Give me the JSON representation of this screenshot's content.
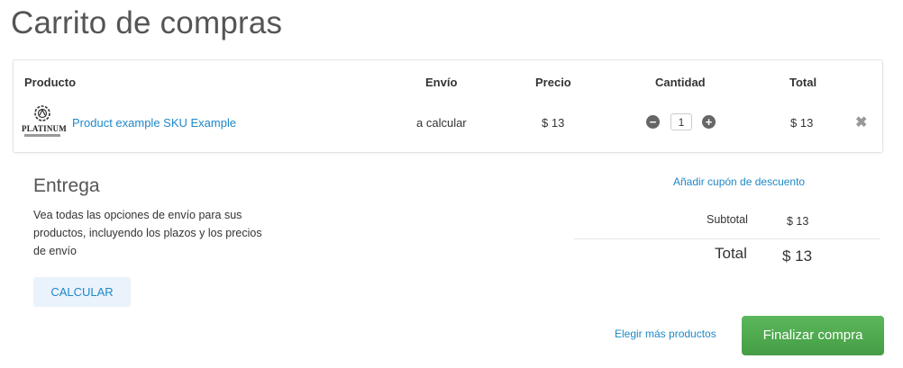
{
  "page": {
    "title": "Carrito de compras"
  },
  "table": {
    "headers": {
      "product": "Producto",
      "envio": "Envío",
      "precio": "Precio",
      "cantidad": "Cantidad",
      "total": "Total"
    },
    "row": {
      "logo_text": "PLATINUM",
      "product_name": "Product example SKU Example",
      "envio": "a calcular",
      "precio": "$ 13",
      "quantity": "1",
      "minus_symbol": "−",
      "plus_symbol": "+",
      "total": "$ 13",
      "remove_symbol": "✖"
    }
  },
  "delivery": {
    "title": "Entrega",
    "description": "Vea todas las opciones de envío para sus productos, incluyendo los plazos y los precios de envío",
    "calculate_label": "CALCULAR"
  },
  "summary": {
    "coupon_label": "Añadir cupón de descuento",
    "subtotal_label": "Subtotal",
    "subtotal_value": "$ 13",
    "total_label": "Total",
    "total_value": "$ 13"
  },
  "actions": {
    "more_products_label": "Elegir más productos",
    "checkout_label": "Finalizar compra"
  },
  "colors": {
    "link": "#1e88c8",
    "checkout": "#5cb85c",
    "calc_bg": "#eaf2fb"
  },
  "icons": {
    "minus": "minus-circle-icon",
    "plus": "plus-circle-icon",
    "remove": "close-icon"
  }
}
